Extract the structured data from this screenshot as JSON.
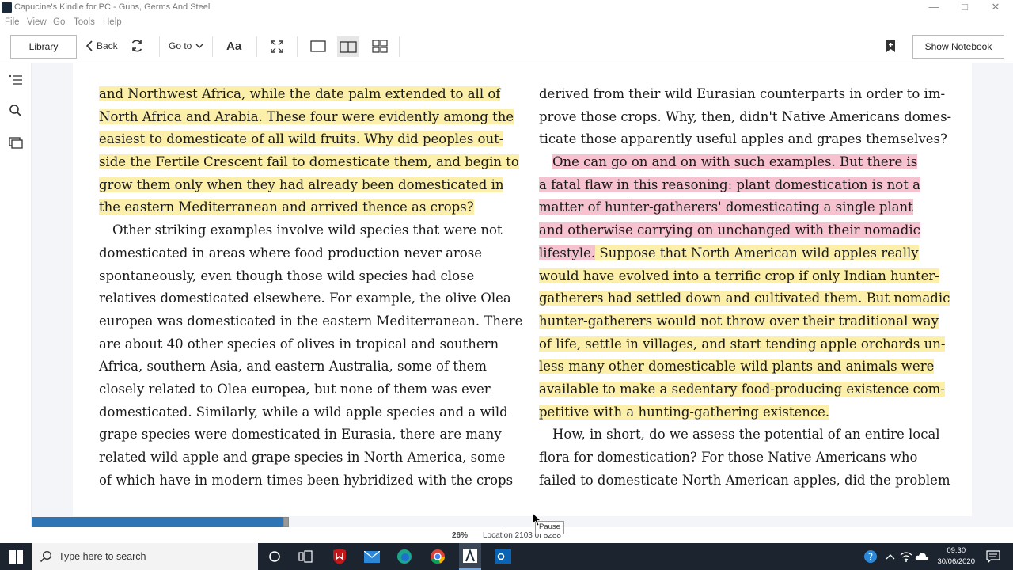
{
  "window": {
    "title": "Capucine's Kindle for PC - Guns, Germs And Steel"
  },
  "menu": [
    "File",
    "View",
    "Go",
    "Tools",
    "Help"
  ],
  "toolbar": {
    "library_label": "Library",
    "back_label": "Back",
    "goto_label": "Go to",
    "font_label": "Aa",
    "notebook_label": "Show Notebook"
  },
  "book": {
    "left_column": [
      {
        "text": "and Northwest Africa, while the date palm extended to all of",
        "hl": "y"
      },
      {
        "text": "North Africa and Arabia. These four were evidently among the",
        "hl": "y"
      },
      {
        "text": "easiest to domesticate of all wild fruits. Why did peoples out-",
        "hl": "y"
      },
      {
        "text": "side the Fertile Crescent fail to domesticate them, and begin to",
        "hl": "y"
      },
      {
        "text": "grow them only when they had already been domesticated in",
        "hl": "y"
      },
      {
        "text": "the eastern Mediterranean and arrived thence as crops?",
        "hl": "y"
      },
      {
        "text": "Other striking examples involve wild species that were not",
        "hl": "",
        "indent": true
      },
      {
        "text": "domesticated in areas where food production never arose",
        "hl": ""
      },
      {
        "text": "spontaneously, even though those wild species had close",
        "hl": ""
      },
      {
        "text": "relatives domesticated elsewhere. For example, the olive Olea",
        "hl": ""
      },
      {
        "text": "europea was domesticated in the eastern Mediterranean. There",
        "hl": ""
      },
      {
        "text": "are about 40 other species of olives in tropical and southern",
        "hl": ""
      },
      {
        "text": "Africa, southern Asia, and eastern Australia, some of them",
        "hl": ""
      },
      {
        "text": "closely related to Olea europea, but none of them was ever",
        "hl": ""
      },
      {
        "text": "domesticated. Similarly, while a wild apple species and a wild",
        "hl": ""
      },
      {
        "text": "grape species were domesticated in Eurasia, there are many",
        "hl": ""
      },
      {
        "text": "related wild apple and grape species in North America, some",
        "hl": ""
      },
      {
        "text": "of which have in modern times been hybridized with the crops",
        "hl": ""
      }
    ],
    "right_column": [
      {
        "text": "derived from their wild Eurasian counterparts in order to im-",
        "hl": ""
      },
      {
        "text": "prove those crops. Why, then, didn't Native Americans domes-",
        "hl": ""
      },
      {
        "text": "ticate those apparently useful apples and grapes themselves?",
        "hl": ""
      },
      {
        "text": "One can go on and on with such examples. But there is",
        "hl": "p",
        "indent": true
      },
      {
        "text": "a fatal flaw in this reasoning: plant domestication is not a",
        "hl": "p"
      },
      {
        "text": "matter of hunter-gatherers' domesticating a single plant",
        "hl": "p"
      },
      {
        "text": "and otherwise carrying on unchanged with their nomadic",
        "hl": "p"
      },
      {
        "text": "lifestyle.",
        "hl": "p",
        "tail": " Suppose that North American wild apples really",
        "tail_hl": "y"
      },
      {
        "text": "would have evolved into a terrific crop if only Indian hunter-",
        "hl": "y"
      },
      {
        "text": "gatherers had settled down and cultivated them. But nomadic",
        "hl": "y"
      },
      {
        "text": "hunter-gatherers would not throw over their traditional way",
        "hl": "y"
      },
      {
        "text": "of life, settle in villages, and start tending apple orchards un-",
        "hl": "y"
      },
      {
        "text": "less many other domesticable wild plants and animals were",
        "hl": "y"
      },
      {
        "text": "available to make a sedentary food-producing existence com-",
        "hl": "y"
      },
      {
        "text": "petitive with a hunting-gathering existence.",
        "hl": "y"
      },
      {
        "text": "How, in short, do we assess the potential of an entire local",
        "hl": "",
        "indent": true
      },
      {
        "text": "flora for domestication? For those Native Americans who",
        "hl": ""
      },
      {
        "text": "failed to domesticate North American apples, did the problem",
        "hl": ""
      }
    ]
  },
  "status": {
    "percent": "26%",
    "location": "Location 2103 of 8288",
    "progress_fraction": 0.26,
    "tooltip": "Pause"
  },
  "taskbar": {
    "search_placeholder": "Type here to search",
    "time": "09:30",
    "date": "30/06/2020"
  },
  "colors": {
    "highlight_yellow": "#fbefa9",
    "highlight_pink": "#f6c2cf",
    "progress": "#2e75b6",
    "taskbar": "#1c2430"
  }
}
